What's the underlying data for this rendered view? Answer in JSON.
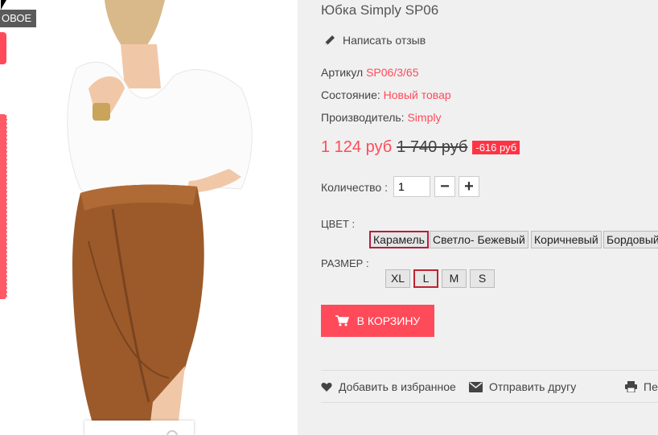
{
  "badge": {
    "label": "ОВОЕ"
  },
  "product": {
    "title": "Юбка Simply SP06",
    "review_label": "Написать отзыв",
    "sku_label": "Артикул",
    "sku_value": "SP06/3/65",
    "condition_label": "Состояние:",
    "condition_value": "Новый товар",
    "maker_label": "Производитель:",
    "maker_value": "Simply",
    "price": "1 124 руб",
    "old_price": "1 740 руб",
    "discount": "-616 руб"
  },
  "quantity": {
    "label": "Количество :",
    "value": "1",
    "minus": "−",
    "plus": "+"
  },
  "color": {
    "label": "ЦВЕТ :",
    "options": [
      "Карамель",
      "Светло- Бежевый",
      "Коричневый",
      "Бордовый"
    ],
    "selected": "Карамель"
  },
  "size": {
    "label": "РАЗМЕР :",
    "options": [
      "XL",
      "L",
      "M",
      "S"
    ],
    "selected": "L"
  },
  "cart": {
    "label": "В КОРЗИНУ"
  },
  "actions": {
    "wishlist": "Добавить в избранное",
    "send": "Отправить другу",
    "print": "Пе"
  },
  "icons": [
    "pencil-icon",
    "cart-icon",
    "heart-icon",
    "envelope-icon",
    "print-icon"
  ],
  "colors": {
    "accent": "#ff4a5a",
    "selected_border": "#b02040",
    "page_bg": "#f0f0f0"
  }
}
